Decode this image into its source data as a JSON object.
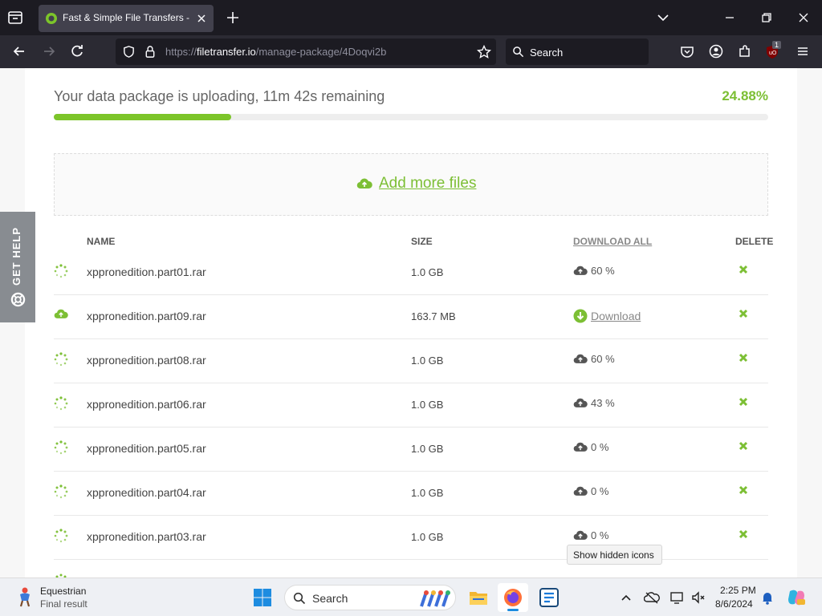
{
  "browser": {
    "tab_title": "Fast & Simple File Transfers - Fi",
    "url_prefix": "https://",
    "url_host": "filetransfer.io",
    "url_path": "/manage-package/4Doqvi2b",
    "search_placeholder": "Search",
    "extension_badge": "1"
  },
  "upload": {
    "status_text": "Your data package is uploading, 11m 42s remaining",
    "percent_label": "24.88%",
    "progress_fraction": 0.2488,
    "add_more_label": "Add more files"
  },
  "help_tab": {
    "label": "GET HELP"
  },
  "table": {
    "headers": {
      "name": "NAME",
      "size": "SIZE",
      "download_all": "DOWNLOAD ALL",
      "delete": "DELETE"
    },
    "rows": [
      {
        "name": "xppronedition.part01.rar",
        "size": "1.0 GB",
        "status": "uploading",
        "download": "60 %"
      },
      {
        "name": "xppronedition.part09.rar",
        "size": "163.7 MB",
        "status": "done",
        "download": "Download"
      },
      {
        "name": "xppronedition.part08.rar",
        "size": "1.0 GB",
        "status": "uploading",
        "download": "60 %"
      },
      {
        "name": "xppronedition.part06.rar",
        "size": "1.0 GB",
        "status": "uploading",
        "download": "43 %"
      },
      {
        "name": "xppronedition.part05.rar",
        "size": "1.0 GB",
        "status": "uploading",
        "download": "0 %"
      },
      {
        "name": "xppronedition.part04.rar",
        "size": "1.0 GB",
        "status": "uploading",
        "download": "0 %"
      },
      {
        "name": "xppronedition.part03.rar",
        "size": "1.0 GB",
        "status": "uploading",
        "download": "0 %"
      }
    ]
  },
  "tooltip": {
    "text": "Show hidden icons"
  },
  "taskbar": {
    "weather_title": "Equestrian",
    "weather_subtitle": "Final result",
    "search_label": "Search",
    "time": "2:25 PM",
    "date": "8/6/2024"
  },
  "colors": {
    "accent_green": "#7cbf34",
    "chrome_dark": "#1c1b22"
  }
}
